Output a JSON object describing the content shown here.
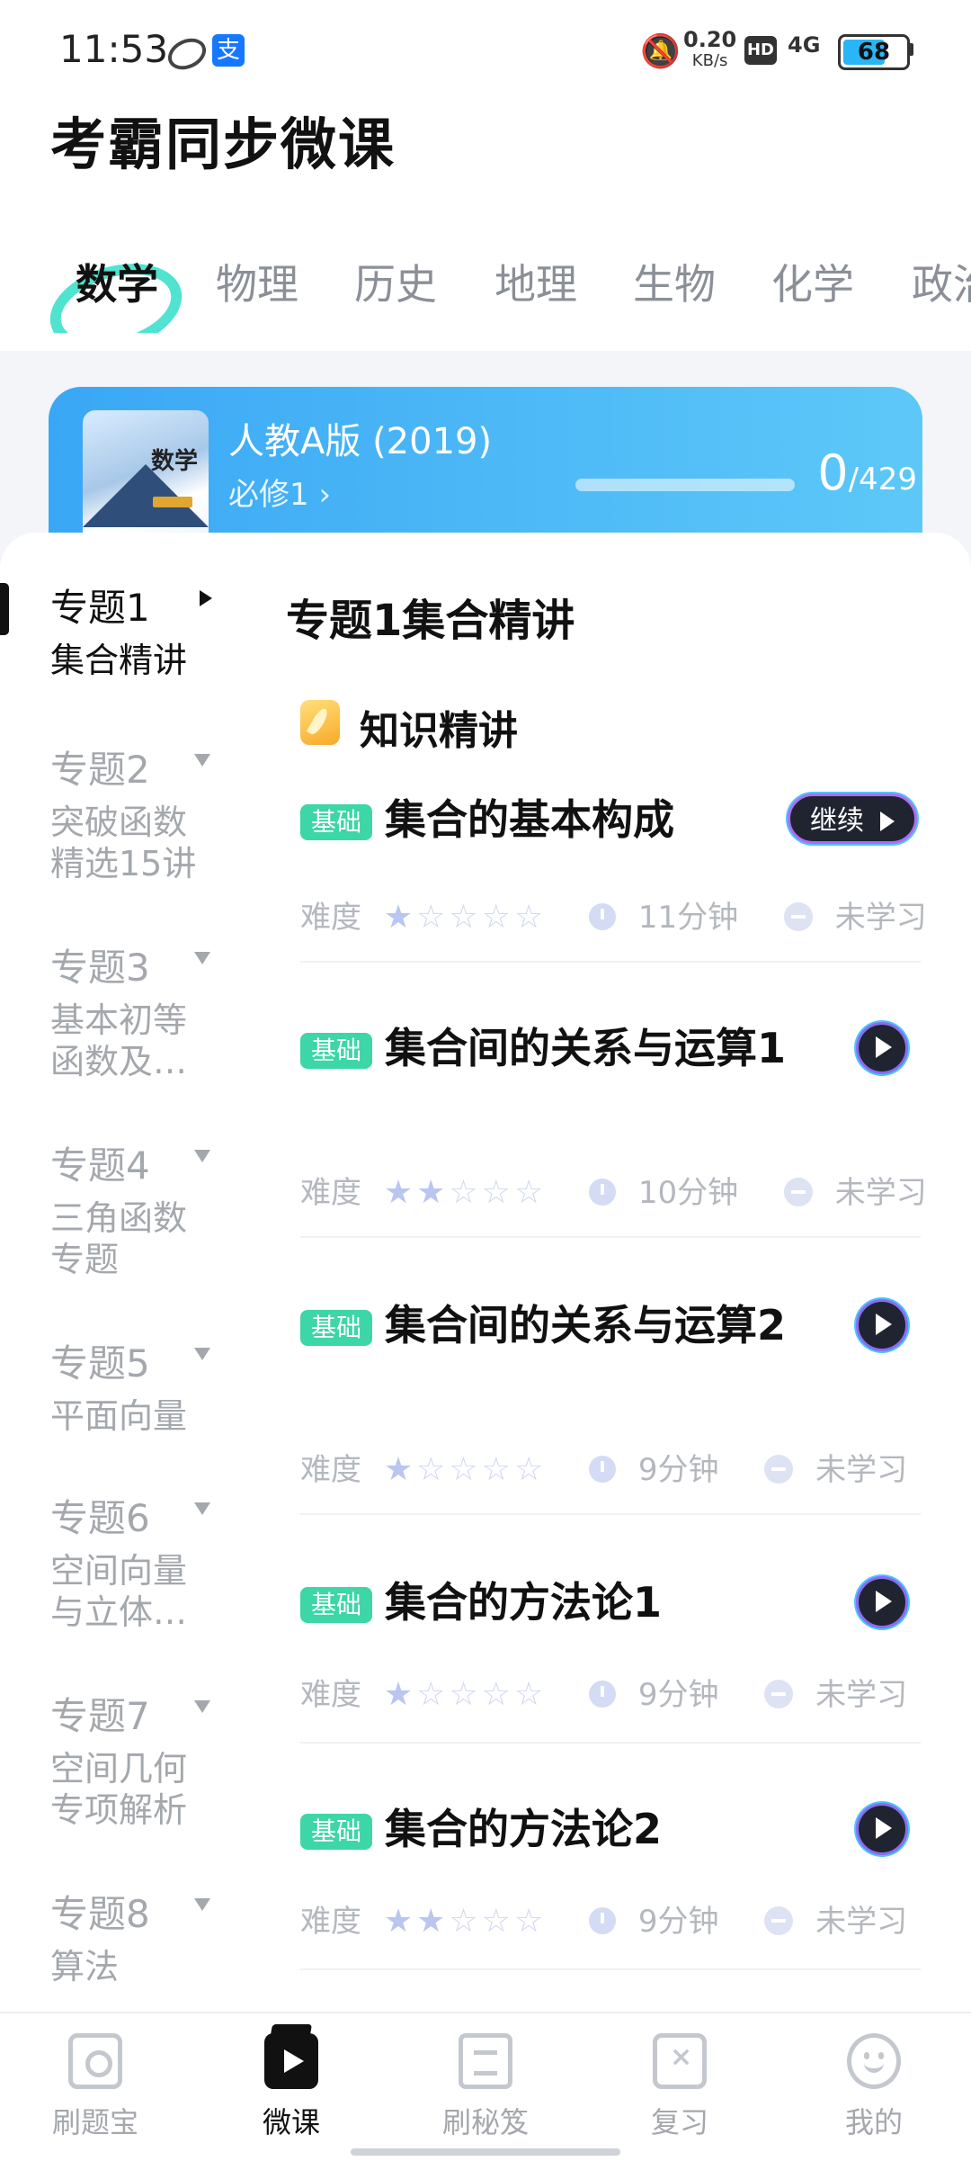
{
  "status_bar": {
    "time": "11:53",
    "speed_value": "0.20",
    "speed_unit": "KB/s",
    "hd": "HD",
    "network": "4G",
    "battery": "68",
    "battery_level": 0.68
  },
  "header": {
    "app_title": "考霸同步微课",
    "subjects": [
      "数学",
      "物理",
      "历史",
      "地理",
      "生物",
      "化学",
      "政治"
    ],
    "active_subject_index": 0
  },
  "book": {
    "edition": "人教A版 (2019)",
    "volume": "必修1",
    "cover_title": "数学",
    "progress_done": "0",
    "progress_total": "/429",
    "progress_fraction": 0
  },
  "topics": [
    {
      "num": "专题1",
      "sub": "集合精讲"
    },
    {
      "num": "专题2",
      "sub": "突破函数\n精选15讲"
    },
    {
      "num": "专题3",
      "sub": "基本初等\n函数及…"
    },
    {
      "num": "专题4",
      "sub": "三角函数\n专题"
    },
    {
      "num": "专题5",
      "sub": "平面向量"
    },
    {
      "num": "专题6",
      "sub": "空间向量\n与立体…"
    },
    {
      "num": "专题7",
      "sub": "空间几何\n专项解析"
    },
    {
      "num": "专题8",
      "sub": "算法"
    }
  ],
  "section": {
    "title": "专题1集合精讲",
    "group_label": "知识精讲",
    "difficulty_label": "难度",
    "continue_label": "继续"
  },
  "lessons": [
    {
      "badge": "基础",
      "title": "集合的基本构成",
      "stars": 1,
      "duration": "11分钟",
      "status": "未学习",
      "action": "continue"
    },
    {
      "badge": "基础",
      "title": "集合间的关系与运算1",
      "stars": 2,
      "duration": "10分钟",
      "status": "未学习",
      "action": "play"
    },
    {
      "badge": "基础",
      "title": "集合间的关系与运算2",
      "stars": 1,
      "duration": "9分钟",
      "status": "未学习",
      "action": "play"
    },
    {
      "badge": "基础",
      "title": "集合的方法论1",
      "stars": 1,
      "duration": "9分钟",
      "status": "未学习",
      "action": "play"
    },
    {
      "badge": "基础",
      "title": "集合的方法论2",
      "stars": 2,
      "duration": "9分钟",
      "status": "未学习",
      "action": "play"
    }
  ],
  "bottom_nav": [
    {
      "label": "刷题宝",
      "icon": "search-book-icon"
    },
    {
      "label": "微课",
      "icon": "video-play-icon"
    },
    {
      "label": "刷秘笈",
      "icon": "scroll-icon"
    },
    {
      "label": "复习",
      "icon": "review-icon"
    },
    {
      "label": "我的",
      "icon": "smiley-icon"
    }
  ],
  "active_nav_index": 1
}
